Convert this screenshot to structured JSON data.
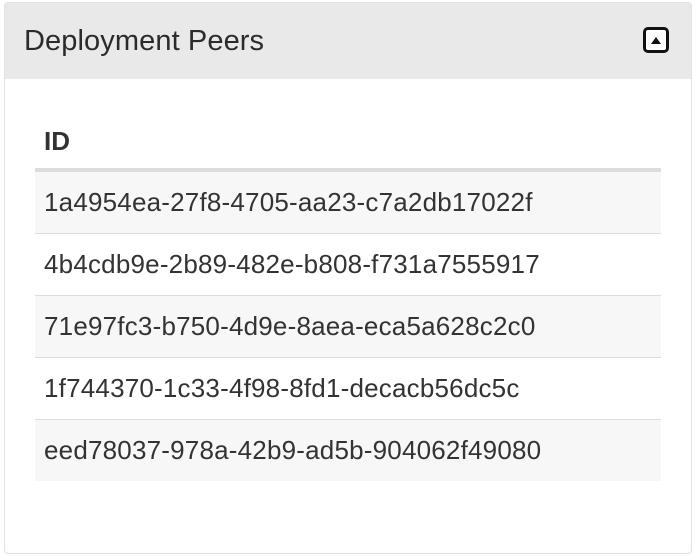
{
  "panel": {
    "title": "Deployment Peers",
    "collapse_icon": "collapse-up-icon"
  },
  "table": {
    "columns": [
      "ID"
    ],
    "rows": [
      "1a4954ea-27f8-4705-aa23-c7a2db17022f",
      "4b4cdb9e-2b89-482e-b808-f731a7555917",
      "71e97fc3-b750-4d9e-8aea-eca5a628c2c0",
      "1f744370-1c33-4f98-8fd1-decacb56dc5c",
      "eed78037-978a-42b9-ad5b-904062f49080"
    ]
  },
  "colors": {
    "header_bg": "#e9e9e9",
    "row_alt_bg": "#f7f7f7",
    "text": "#333333"
  }
}
